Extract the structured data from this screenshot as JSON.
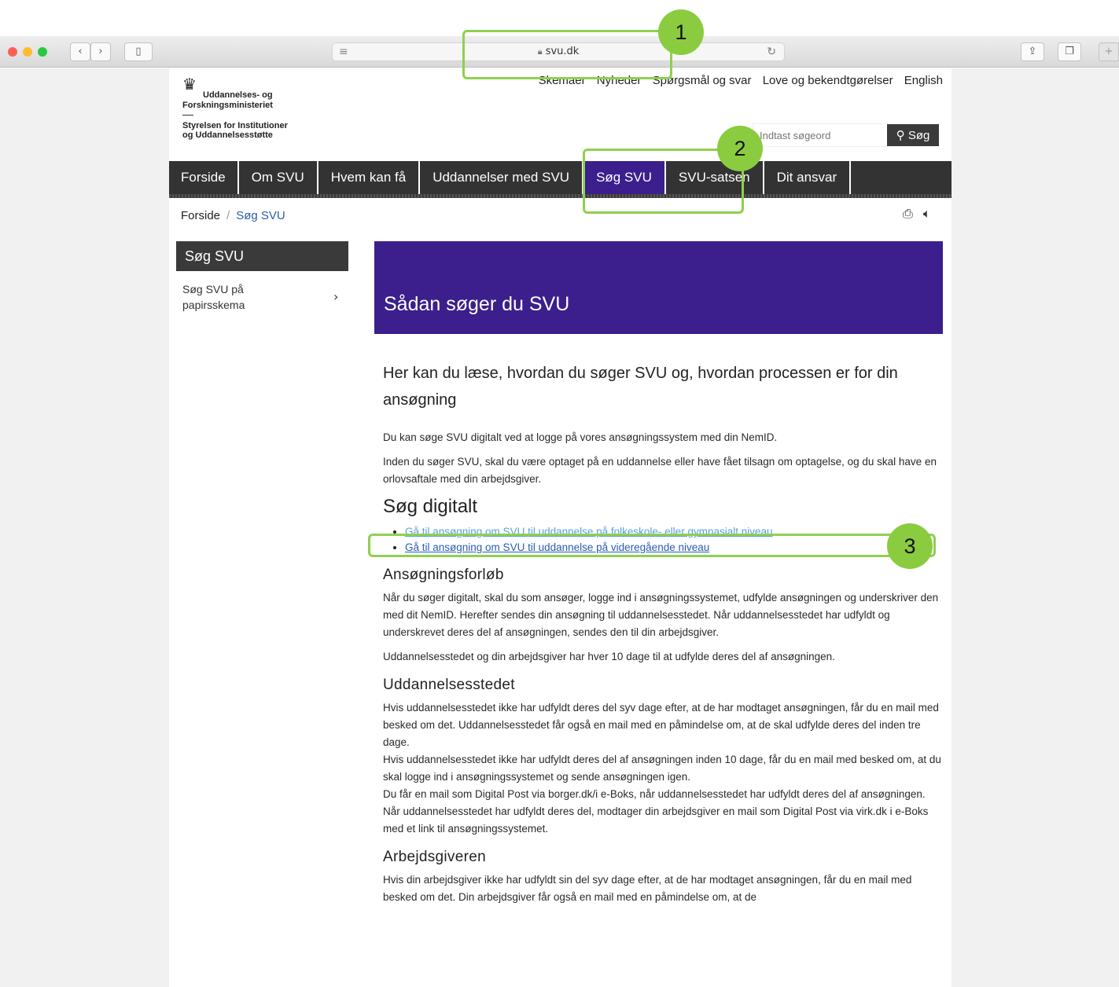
{
  "browser": {
    "url": "svu.dk",
    "reader_icon": "reader-icon",
    "reload_icon": "reload-icon",
    "back_icon": "back-icon",
    "forward_icon": "forward-icon",
    "sidebar_icon": "sidebar-icon",
    "share_icon": "share-icon",
    "tabs_icon": "tabs-icon",
    "new_tab_label": "+",
    "colors": {
      "close": "#ff5f57",
      "minimize": "#febc2e",
      "zoom": "#28c840"
    }
  },
  "header": {
    "top_links": [
      "Skemaer",
      "Nyheder",
      "Spørgsmål og svar",
      "Love og bekendtgørelser",
      "English"
    ],
    "logo": {
      "line1": "Uddannelses- og",
      "line2": "Forskningsministeriet",
      "line3": "Styrelsen for Institutioner",
      "line4": "og Uddannelsesstøtte"
    },
    "search_placeholder": "Indtast søgeord",
    "search_button": "Søg"
  },
  "nav": {
    "items": [
      "Forside",
      "Om SVU",
      "Hvem kan få",
      "Uddannelser med SVU",
      "Søg SVU",
      "SVU-satsen",
      "Dit ansvar"
    ],
    "active": "Søg SVU",
    "active_color": "#3c1f8c"
  },
  "breadcrumb": {
    "home": "Forside",
    "separator": "/",
    "current": "Søg SVU"
  },
  "sidebar": {
    "heading": "Søg SVU",
    "items": [
      {
        "label": "Søg SVU på papirsskema",
        "chevron": "›"
      }
    ]
  },
  "main": {
    "hero_title": "Sådan søger du SVU",
    "lead": "Her kan du læse, hvordan du søger SVU og, hvordan processen er for din ansøgning",
    "intro1": "Du kan søge SVU digitalt ved at logge på vores ansøgningssystem med din NemID.",
    "intro2": "Inden du søger SVU, skal du være optaget på en uddannelse eller have fået tilsagn om optagelse, og du skal have en orlovsaftale med din arbejdsgiver.",
    "digital_heading": "Søg digitalt",
    "links": [
      "Gå til ansøgning om SVU til uddannelse på folkeskole- eller gymnasialt niveau",
      "Gå til ansøgning om SVU til uddannelse på videregående niveau"
    ],
    "process_heading": "Ansøgningsforløb",
    "process_p1": "Når du søger digitalt, skal du som ansøger, logge ind i ansøgningssystemet, udfylde ansøgningen og underskriver den med dit NemID. Herefter sendes din ansøgning til uddannelsesstedet. Når uddannelsesstedet har udfyldt og underskrevet deres del af ansøgningen, sendes den til din arbejdsgiver.",
    "process_p2": "Uddannelsesstedet og din arbejdsgiver har hver 10 dage til at udfylde deres del af ansøgningen.",
    "school_heading": "Uddannelsesstedet",
    "school_p1": "Hvis uddannelsesstedet ikke har udfyldt deres del syv dage efter, at de har modtaget ansøgningen, får du en mail med besked om det. Uddannelsesstedet får også en mail med en påmindelse om, at de skal udfylde deres del inden tre dage.",
    "school_p2": "Hvis uddannelsesstedet ikke har udfyldt deres del af ansøgningen inden 10 dage, får du en mail med besked om, at du skal logge ind i ansøgningssystemet og sende ansøgningen igen.",
    "school_p3": "Du får en mail som Digital Post via borger.dk/i e-Boks, når uddannelsesstedet har udfyldt deres del af ansøgningen.",
    "school_p4": "Når uddannelsesstedet har udfyldt deres del, modtager din arbejdsgiver en mail som Digital Post via virk.dk i e-Boks med et link til ansøgningssystemet.",
    "employer_heading": "Arbejdsgiveren",
    "employer_p1": "Hvis din arbejdsgiver ikke har udfyldt sin del syv dage efter, at de har modtaget ansøgningen, får du en mail med besked om det. Din arbejdsgiver får også en mail med en påmindelse om, at de"
  },
  "annotations": {
    "labels": [
      "1",
      "2",
      "3"
    ],
    "color": "#8bcb3f"
  }
}
